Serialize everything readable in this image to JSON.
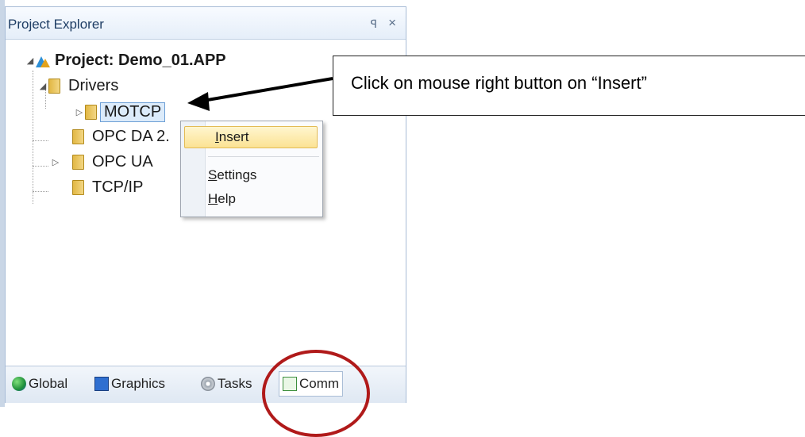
{
  "panel": {
    "title": "Project Explorer",
    "pin_glyph": "ꟼ",
    "close_glyph": "×"
  },
  "tree": {
    "root": {
      "label": "Project: Demo_01.APP",
      "icon": "project-icon"
    },
    "drivers": {
      "label": "Drivers"
    },
    "motcp": {
      "label": "MOTCP"
    },
    "opc_da": {
      "label": "OPC DA 2."
    },
    "opc_ua": {
      "label": "OPC UA"
    },
    "tcpip": {
      "label": "TCP/IP"
    }
  },
  "context_menu": {
    "items": [
      {
        "label": "Insert",
        "underline": "I"
      },
      {
        "label": "Settings",
        "underline": "S"
      },
      {
        "label": "Help",
        "underline": "H"
      }
    ]
  },
  "bottom_tabs": [
    {
      "label": "Global",
      "icon": "globe-icon"
    },
    {
      "label": "Graphics",
      "icon": "graphics-icon"
    },
    {
      "label": "Tasks",
      "icon": "tasks-icon"
    },
    {
      "label": "Comm",
      "icon": "comm-icon",
      "active": true
    }
  ],
  "annotation": {
    "text": "Click on mouse right button on “Insert”",
    "circle_color": "#b01a1a"
  }
}
